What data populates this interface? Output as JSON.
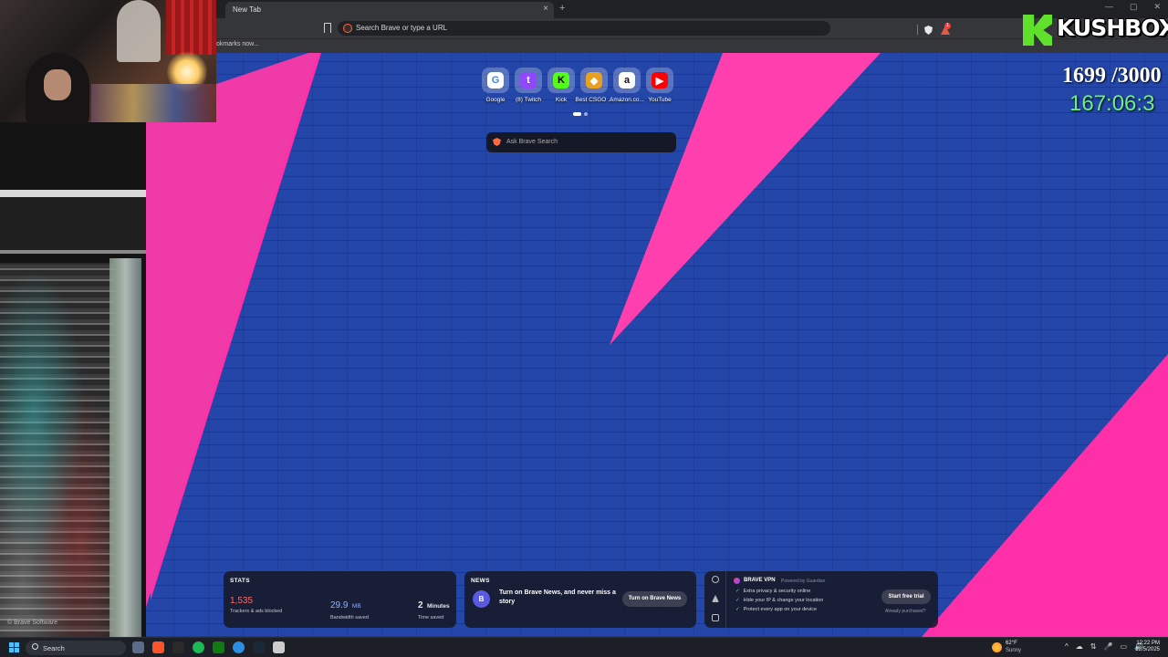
{
  "browser": {
    "tab_title": "New Tab",
    "tab_close": "×",
    "new_tab": "+",
    "url_placeholder": "Search Brave or type a URL",
    "bookmarks_text": "okmarks now...",
    "window_controls": [
      "—",
      "▢",
      "✕"
    ],
    "rewards_badge": "1"
  },
  "top_sites": [
    {
      "label": "Google",
      "glyph": "G",
      "icon": "google-icon",
      "color": "#ffffff",
      "text_color": "#4285f4"
    },
    {
      "label": "(8) Twitch",
      "glyph": "t",
      "icon": "twitch-icon",
      "color": "#9146ff",
      "text_color": "#ffffff"
    },
    {
      "label": "Kick",
      "glyph": "K",
      "icon": "kick-icon",
      "color": "#53fc18",
      "text_color": "#000000"
    },
    {
      "label": "Best CSGO ...",
      "glyph": "◆",
      "icon": "csgo-case-icon",
      "color": "#e8a020",
      "text_color": "#ffffff"
    },
    {
      "label": "Amazon.co...",
      "glyph": "a",
      "icon": "amazon-icon",
      "color": "#ffffff",
      "text_color": "#111111"
    },
    {
      "label": "YouTube",
      "glyph": "▶",
      "icon": "youtube-icon",
      "color": "#ff0000",
      "text_color": "#ffffff"
    }
  ],
  "search": {
    "placeholder": "Ask Brave Search"
  },
  "stats": {
    "title": "STATS",
    "trackers": {
      "value": "1,535",
      "label": "Trackers & ads blocked",
      "color": "#ff6b6b"
    },
    "bandwidth": {
      "value": "29.9",
      "unit": "MB",
      "label": "Bandwidth saved",
      "color": "#8ab4ff"
    },
    "time": {
      "value": "2",
      "unit": "Minutes",
      "label": "Time saved",
      "color": "#ffffff"
    }
  },
  "news": {
    "title": "NEWS",
    "icon": "B",
    "text": "Turn on Brave News, and never miss a story",
    "button": "Turn on Brave News"
  },
  "vpn": {
    "title": "BRAVE VPN",
    "powered": "Powered by Guardian",
    "features": [
      "Extra privacy & security online",
      "Hide your IP & change your location",
      "Protect every app on your device"
    ],
    "button": "Start free trial",
    "already": "Already purchased?"
  },
  "wallpaper": {
    "credit": "© Brave Software"
  },
  "overlay": {
    "brand": "KUSHBOX",
    "counter": "1699 /3000",
    "timer": "167:06:3",
    "timer_color": "#6cf084"
  },
  "taskbar": {
    "search": "Search",
    "weather_temp": "62°F",
    "weather_cond": "Sunny",
    "time": "12:22 PM",
    "date": "12/5/2025",
    "tray_icons": [
      "^",
      "☁",
      "⇅",
      "🎤",
      "▭",
      "🔊"
    ],
    "apps": [
      {
        "icon": "widgets-icon",
        "color": "#5b6b8a"
      },
      {
        "icon": "brave-icon",
        "color": "#fb542b"
      },
      {
        "icon": "terminal-icon",
        "color": "#2a2a2a"
      },
      {
        "icon": "spotify-icon",
        "color": "#1db954"
      },
      {
        "icon": "xbox-icon",
        "color": "#107c10"
      },
      {
        "icon": "edge-icon",
        "color": "#2a8fe0"
      },
      {
        "icon": "steam-icon",
        "color": "#1b2838"
      },
      {
        "icon": "notepad-icon",
        "color": "#cccccc"
      }
    ]
  }
}
